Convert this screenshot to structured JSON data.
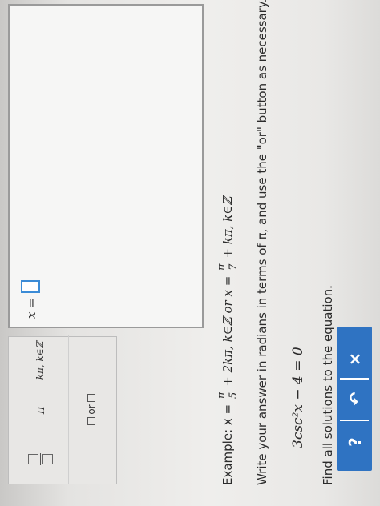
{
  "question": {
    "instruction": "Find all solutions to the equation.",
    "equation": "3csc²x − 4 = 0",
    "directions": "Write your answer in radians in terms of π, and use the \"or\" button as necessary.",
    "example_prefix": "Example: x =",
    "example_num1": "π",
    "example_den1": "5",
    "example_mid": "+ 2kπ, k∈ℤ or x =",
    "example_num2": "π",
    "example_den2": "7",
    "example_end": "+ kπ, k∈ℤ"
  },
  "answer": {
    "label": "x ="
  },
  "palette": {
    "pi_label": "π",
    "kpi_label": "kπ, k∈ℤ",
    "or_label": "or",
    "clear_label": "×",
    "undo_label": "↶",
    "help_label": "?"
  },
  "colors": {
    "accent": "#2f73c2",
    "input_border": "#3b8bd6"
  }
}
